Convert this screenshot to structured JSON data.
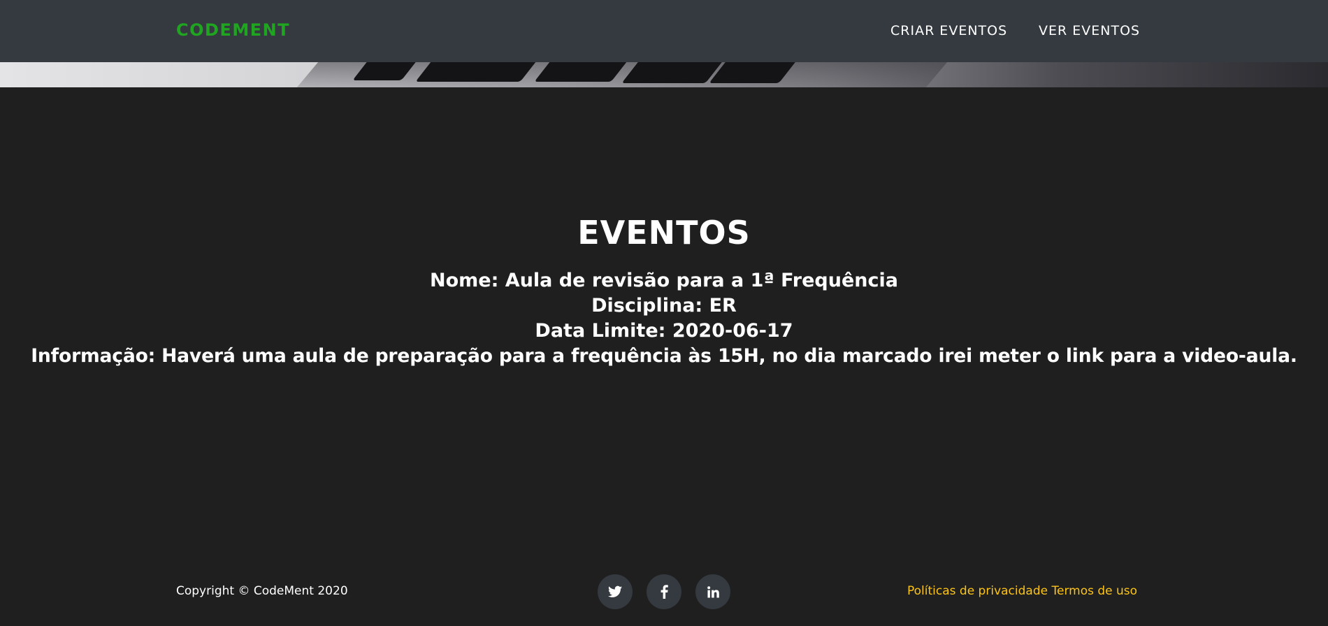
{
  "navbar": {
    "brand": "CODEMENT",
    "links": [
      {
        "label": "CRIAR EVENTOS"
      },
      {
        "label": "VER EVENTOS"
      }
    ]
  },
  "main": {
    "title": "EVENTOS",
    "event": {
      "name_line": "Nome: Aula de revisão para a 1ª Frequência",
      "subject_line": "Disciplina: ER",
      "deadline_line": "Data Limite: 2020-06-17",
      "info_line": "Informação: Haverá uma aula de preparação para a frequência às 15H, no dia marcado irei meter o link para a video-aula."
    }
  },
  "footer": {
    "copyright": "Copyright © CodeMent 2020",
    "social": [
      {
        "icon": "twitter-icon"
      },
      {
        "icon": "facebook-icon"
      },
      {
        "icon": "linkedin-icon"
      }
    ],
    "privacy": "Políticas de privacidade",
    "terms": "Termos de uso"
  },
  "colors": {
    "navbar_bg": "#343a40",
    "page_bg": "#1f1f1f",
    "brand": "#1fa51f",
    "footer_link": "#fcc419"
  }
}
